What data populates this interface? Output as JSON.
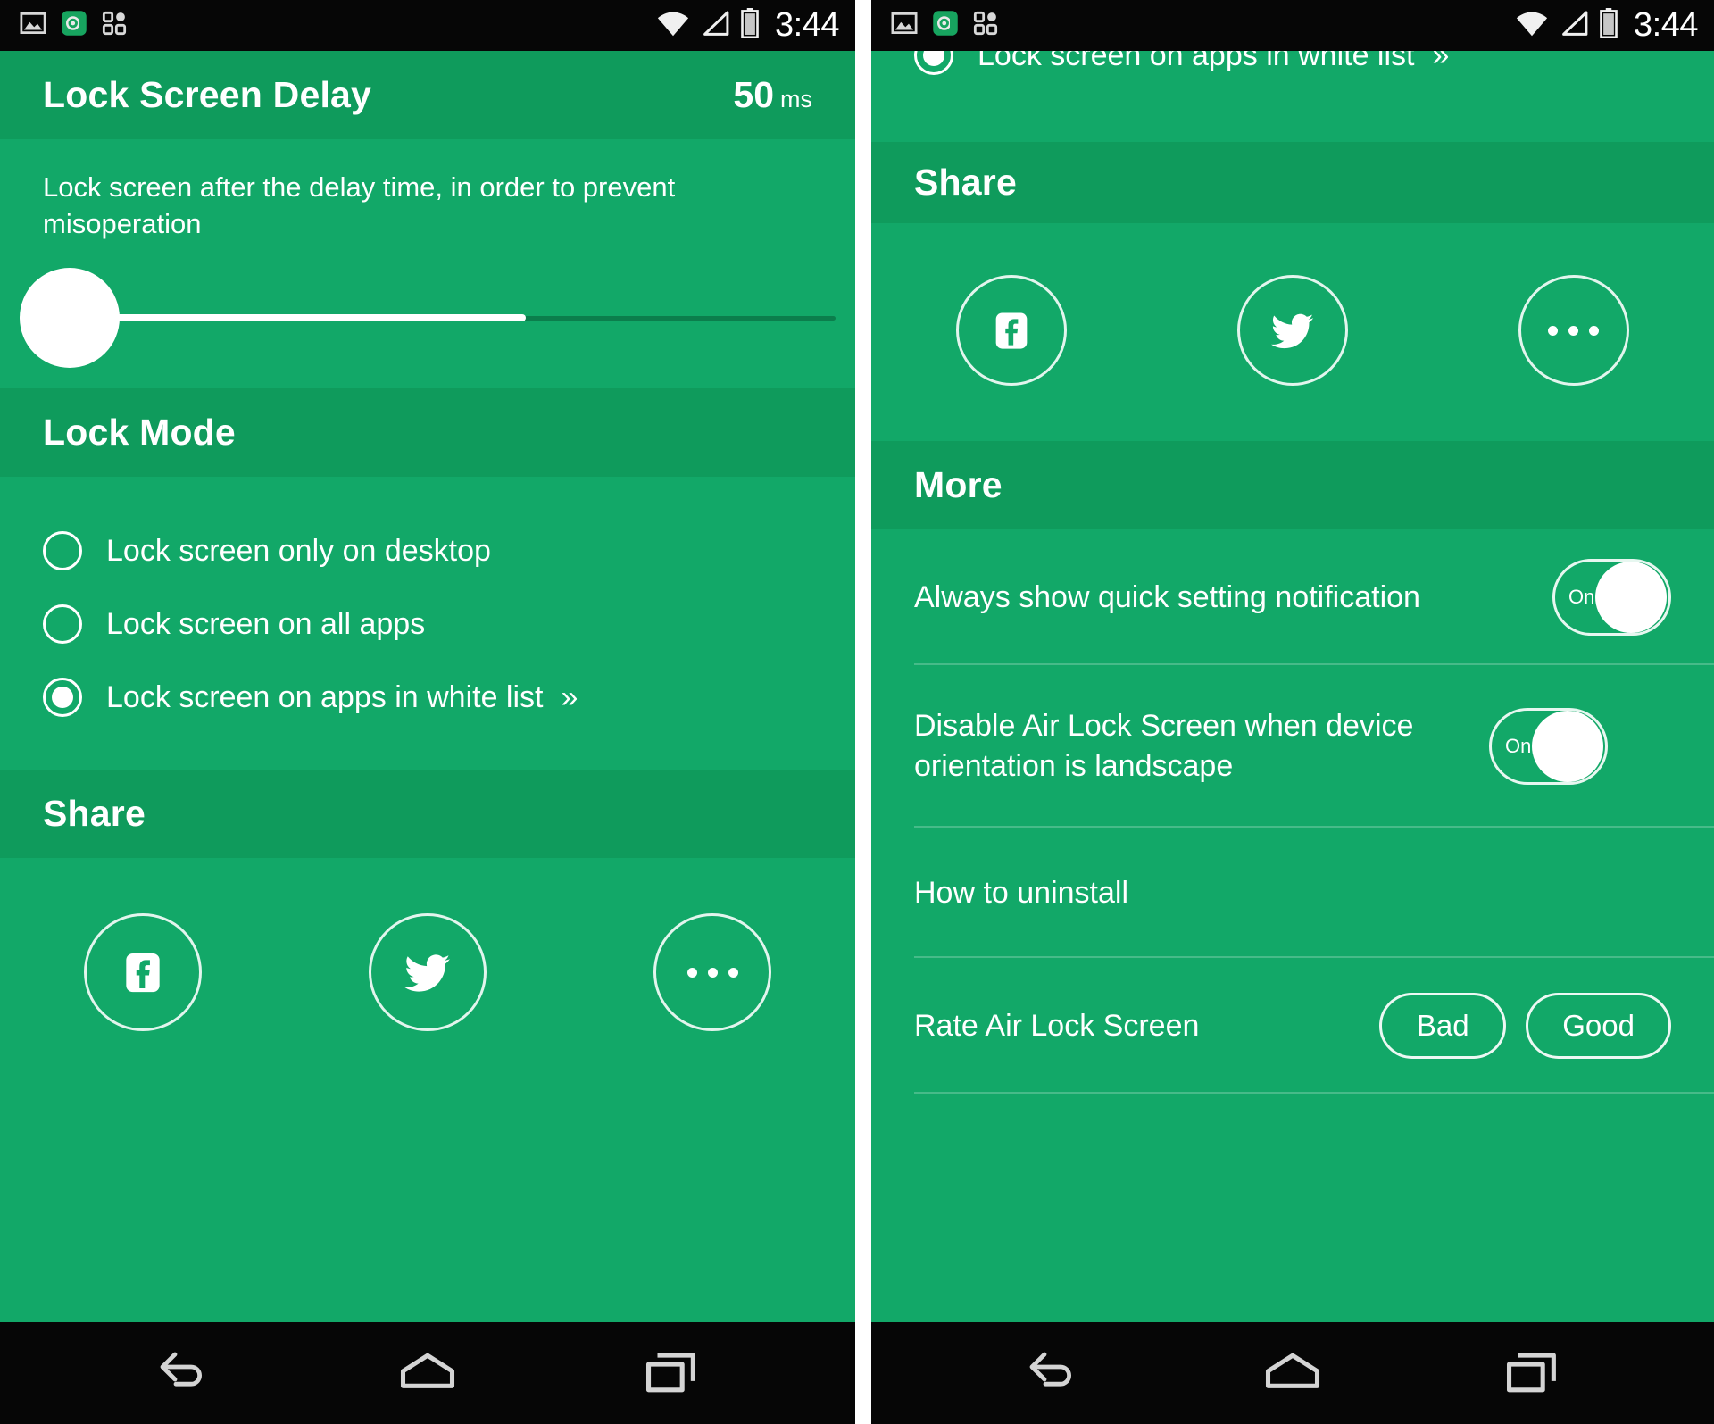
{
  "theme": {
    "header_green": "#0F9B5C",
    "body_green": "#12A868",
    "bar_black": "#060606",
    "accent_white": "#FFFFFF"
  },
  "status_bar": {
    "time": "3:44",
    "notification_icons": [
      "image-icon",
      "app-badge-icon",
      "apps-grid-icon"
    ],
    "system_icons": [
      "wifi-icon",
      "signal-icon",
      "battery-icon"
    ]
  },
  "nav_bar": {
    "back_label": "Back",
    "home_label": "Home",
    "recents_label": "Recent apps"
  },
  "left_screen": {
    "delay_section": {
      "title": "Lock Screen Delay",
      "value": "50",
      "unit": "ms",
      "description": "Lock screen after the delay time, in order to prevent misoperation",
      "slider": {
        "position_percent": 0,
        "fill_percent": 62
      }
    },
    "lock_mode_section": {
      "title": "Lock Mode",
      "options": [
        {
          "label": "Lock screen only on desktop",
          "selected": false,
          "chevrons": ""
        },
        {
          "label": "Lock screen on all apps",
          "selected": false,
          "chevrons": ""
        },
        {
          "label": "Lock screen on apps in white list",
          "selected": true,
          "chevrons": "»"
        }
      ]
    },
    "share_section": {
      "title": "Share",
      "buttons": [
        {
          "name": "facebook",
          "label": "Facebook"
        },
        {
          "name": "twitter",
          "label": "Twitter"
        },
        {
          "name": "more",
          "label": "More"
        }
      ]
    }
  },
  "right_screen": {
    "clipped_row": {
      "label": "Lock screen on apps in white list",
      "chevrons": "»",
      "selected": true
    },
    "share_section": {
      "title": "Share",
      "buttons": [
        {
          "name": "facebook",
          "label": "Facebook"
        },
        {
          "name": "twitter",
          "label": "Twitter"
        },
        {
          "name": "more",
          "label": "More"
        }
      ]
    },
    "more_section": {
      "title": "More",
      "rows": [
        {
          "label": "Always show quick setting notification",
          "control": "toggle",
          "state": "On"
        },
        {
          "label": "Disable Air Lock Screen when device orientation is landscape",
          "control": "toggle",
          "state": "On"
        },
        {
          "label": "How to uninstall",
          "control": "none",
          "state": ""
        },
        {
          "label": "Rate Air Lock Screen",
          "control": "pills",
          "pills": [
            "Bad",
            "Good"
          ]
        }
      ]
    }
  }
}
